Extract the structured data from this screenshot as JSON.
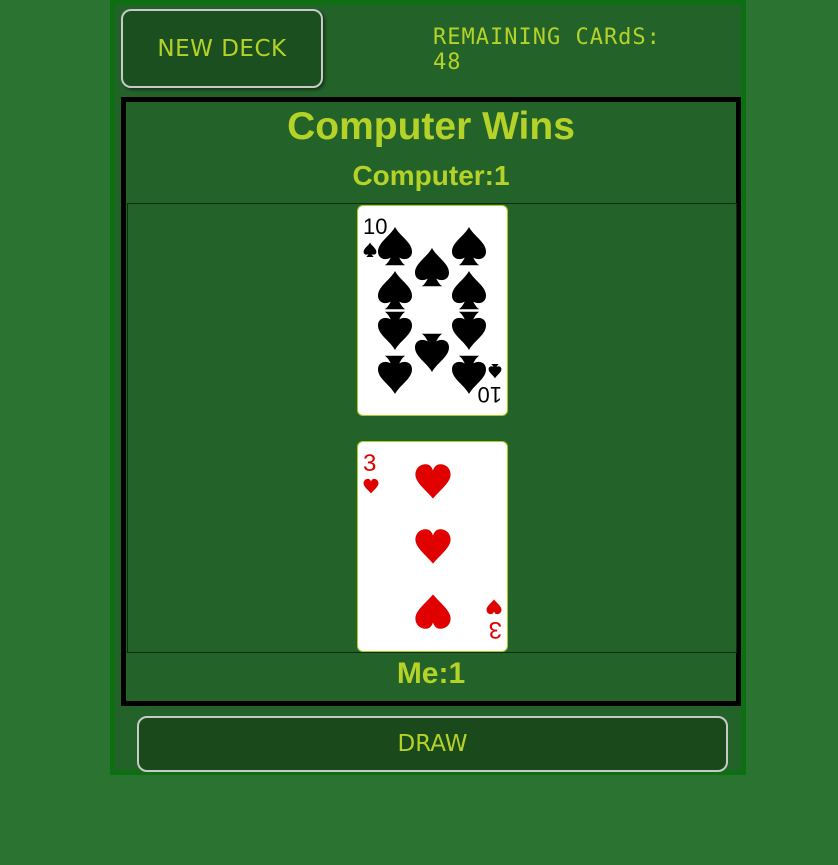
{
  "header": {
    "new_deck_label": "NEW DECK",
    "remaining_label": "REMAINING CARdS: 48"
  },
  "board": {
    "result": "Computer Wins",
    "computer_score": "Computer:1",
    "me_score": "Me:1"
  },
  "computer_card": {
    "rank": "10",
    "suit": "spades",
    "color": "#000000"
  },
  "player_card": {
    "rank": "3",
    "suit": "hearts",
    "color": "#e00000"
  },
  "footer": {
    "draw_label": "DRAW"
  },
  "colors": {
    "background": "#2b7330",
    "panel": "#23632a",
    "accent_text": "#b5d229",
    "button_fill": "#1a4a1c",
    "frame_border": "#0d6f12"
  }
}
